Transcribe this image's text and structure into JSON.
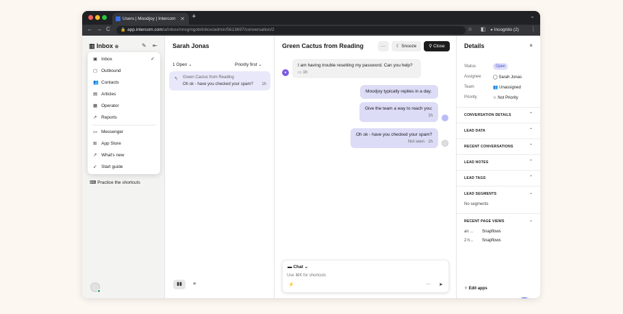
{
  "browser": {
    "tab_title": "Users | Moodjoy | Intercom",
    "url_host": "app.intercom.com",
    "url_path": "/a/inbox/nnxgmgob/inbox/admin/5613697/conversation/2",
    "profile": "Incognito (2)"
  },
  "nav": {
    "title": "Inbox",
    "menu": [
      {
        "label": "Inbox",
        "icon": "inbox-icon",
        "checked": true
      },
      {
        "label": "Outbound",
        "icon": "outbound-icon"
      },
      {
        "label": "Contacts",
        "icon": "contacts-icon"
      },
      {
        "label": "Articles",
        "icon": "articles-icon"
      },
      {
        "label": "Operator",
        "icon": "operator-icon"
      },
      {
        "label": "Reports",
        "icon": "reports-icon"
      },
      {
        "label": "Messenger",
        "icon": "messenger-icon"
      },
      {
        "label": "App Store",
        "icon": "app-store-icon"
      },
      {
        "label": "What's new",
        "icon": "whats-new-icon"
      },
      {
        "label": "Start guide",
        "icon": "start-guide-icon"
      }
    ],
    "shortcuts": "Practice the shortcuts"
  },
  "conversation_list": {
    "title": "Sarah Jonas",
    "filter_open": "1 Open",
    "filter_sort": "Priority first",
    "items": [
      {
        "name": "Green Cactus from Reading",
        "preview": "Oh ok - have you checked your spam?",
        "time": "1h"
      }
    ]
  },
  "conversation": {
    "title": "Green Cactus from Reading",
    "more": "···",
    "snooze": "Snooze",
    "close": "Close",
    "messages": [
      {
        "text": "I am having trouble resetting my password. Can you help?",
        "meta": "1h"
      },
      {
        "text": "Moodjoy typically replies in a day.",
        "meta": ""
      },
      {
        "text": "Give the team a way to reach you:",
        "meta": "1h"
      },
      {
        "text": "Oh ok - have you checked your spam?",
        "meta": "Not seen · 1h"
      }
    ],
    "composer": {
      "mode": "Chat",
      "placeholder": "Use ⌘K for shortcuts"
    }
  },
  "details": {
    "title": "Details",
    "status_label": "Status",
    "status_value": "Open",
    "assignee_label": "Assignee",
    "assignee_value": "Sarah Jonas",
    "team_label": "Team",
    "team_value": "Unassigned",
    "priority_label": "Priority",
    "priority_value": "Not Priority",
    "sections": [
      {
        "label": "CONVERSATION DETAILS"
      },
      {
        "label": "LEAD DATA"
      },
      {
        "label": "RECENT CONVERSATIONS"
      },
      {
        "label": "LEAD NOTES"
      },
      {
        "label": "LEAD TAGS"
      },
      {
        "label": "LEAD SEGMENTS"
      },
      {
        "label": "RECENT PAGE VIEWS"
      }
    ],
    "no_segments": "No segments",
    "page_views": [
      {
        "when": "an ...",
        "page": "Snapflows"
      },
      {
        "when": "2 h...",
        "page": "Snapflows"
      }
    ],
    "edit_apps": "Edit apps"
  },
  "colors": {
    "accent": "#3b4be0",
    "status_bg": "#dfe1fa",
    "selected_conv": "#e8e8fa"
  }
}
